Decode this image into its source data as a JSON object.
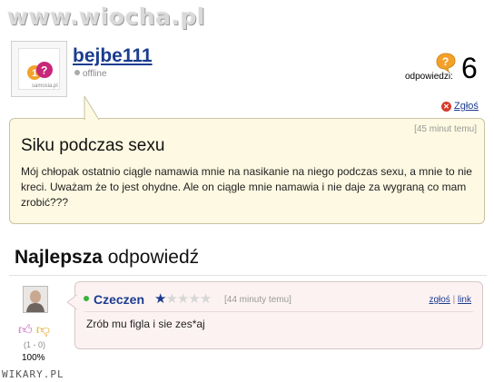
{
  "watermarks": {
    "top": "www.wiocha.pl",
    "bottom": "WIKARY.PL"
  },
  "question": {
    "user": {
      "avatar_brand": "samosia.pl",
      "name": "bejbe111",
      "status": "offline"
    },
    "answers_label": "odpowiedzi:",
    "answers_count": "6",
    "report_label": "Zgłoś",
    "time": "[45 minut temu]",
    "title": "Siku podczas sexu",
    "body": "Mój chłopak ostatnio ciągle namawia mnie na nasikanie na niego podczas sexu, a mnie to nie kreci. Uważam że to jest ohydne. Ale on ciągle mnie namawia i nie daje za wygraną co mam zrobić???"
  },
  "best_answer": {
    "heading_bold": "Najlepsza",
    "heading_rest": " odpowiedź",
    "votes_counts": "(1 - 0)",
    "votes_percent": "100%",
    "user": "Czeczen",
    "rating": 1,
    "rating_max": 5,
    "time": "[44 minuty temu]",
    "report_label": "zgłoś",
    "separator": "|",
    "link_label": "link",
    "body": "Zrób mu figla i sie zes*aj"
  },
  "colors": {
    "link": "#1b3c8f",
    "question_bg": "#fdf9e2",
    "answer_bg": "#fdf2f2",
    "online": "#38b338"
  },
  "icons": {
    "answers": "question-bubble-icon",
    "report": "report-x-icon",
    "thumb_up": "thumb-up-icon",
    "thumb_down": "thumb-down-icon",
    "star": "star-icon"
  }
}
